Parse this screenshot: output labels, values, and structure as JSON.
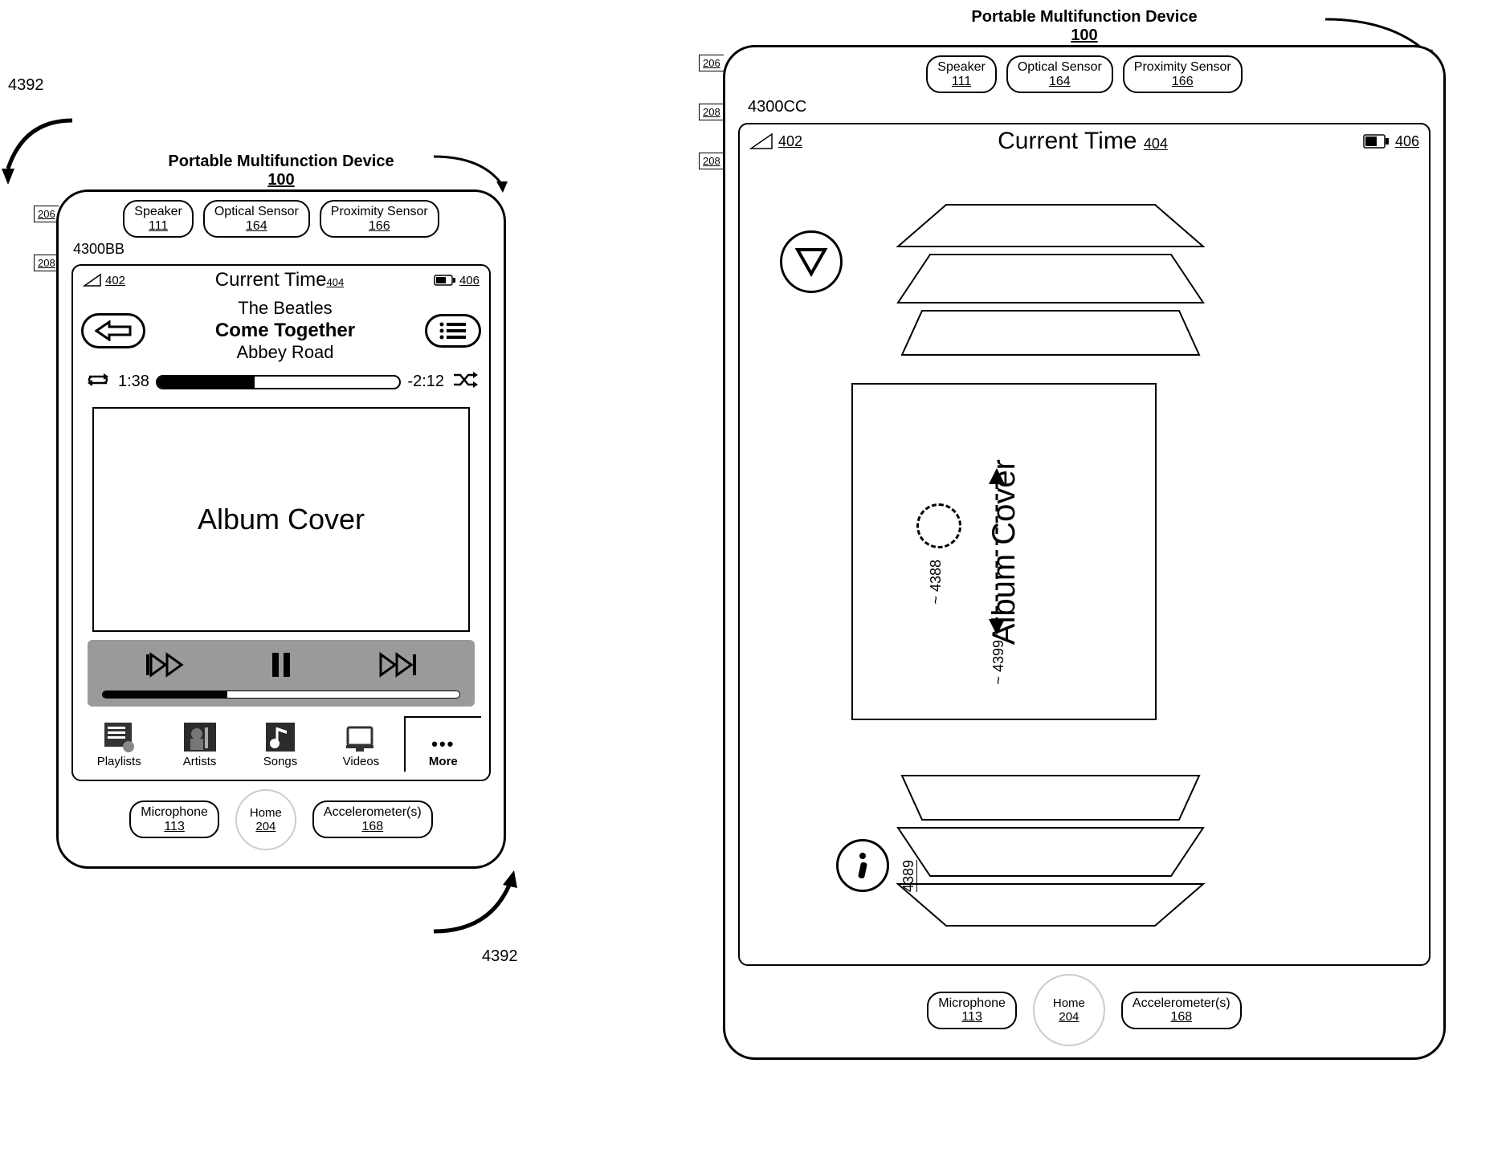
{
  "left": {
    "title": "Portable Multifunction Device",
    "device_num": "100",
    "screen_id": "4300BB",
    "tabs": [
      "206",
      "208"
    ],
    "rotate_ref": "4392",
    "sensors": [
      {
        "label": "Speaker",
        "num": "111"
      },
      {
        "label": "Optical Sensor",
        "num": "164"
      },
      {
        "label": "Proximity Sensor",
        "num": "166"
      }
    ],
    "status": {
      "sig_ref": "402",
      "time": "Current Time",
      "time_ref": "404",
      "batt_ref": "406"
    },
    "now_playing": {
      "artist": "The Beatles",
      "title": "Come Together",
      "album": "Abbey Road"
    },
    "progress": {
      "elapsed": "1:38",
      "remaining": "-2:12"
    },
    "album_label": "Album Cover",
    "tabbar": {
      "playlists": "Playlists",
      "artists": "Artists",
      "songs": "Songs",
      "videos": "Videos",
      "more": "More"
    },
    "bottom": [
      {
        "label": "Microphone",
        "num": "113"
      },
      {
        "label": "Home",
        "num": "204"
      },
      {
        "label": "Accelerometer(s)",
        "num": "168"
      }
    ]
  },
  "right": {
    "title": "Portable Multifunction Device",
    "device_num": "100",
    "screen_id": "4300CC",
    "tabs": [
      "206",
      "208",
      "208"
    ],
    "sensors": [
      {
        "label": "Speaker",
        "num": "111"
      },
      {
        "label": "Optical Sensor",
        "num": "164"
      },
      {
        "label": "Proximity Sensor",
        "num": "166"
      }
    ],
    "status": {
      "sig_ref": "402",
      "time": "Current Time",
      "time_ref": "404",
      "batt_ref": "406"
    },
    "album_label": "Album Cover",
    "touch_ref": "4388",
    "gesture_ref": "4399",
    "info_ref": "4389",
    "bottom": [
      {
        "label": "Microphone",
        "num": "113"
      },
      {
        "label": "Home",
        "num": "204"
      },
      {
        "label": "Accelerometer(s)",
        "num": "168"
      }
    ]
  }
}
